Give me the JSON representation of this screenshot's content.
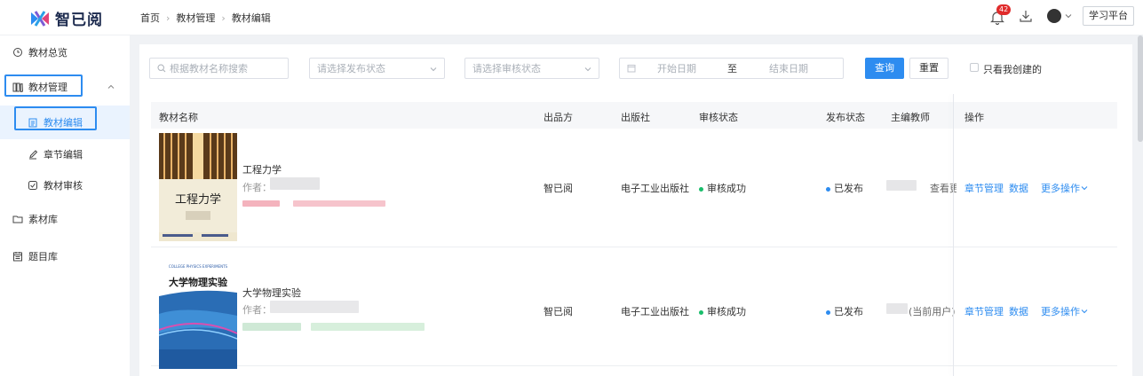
{
  "app": {
    "logo_text": "智已阅",
    "platform_button": "学习平台",
    "notification_count": "42"
  },
  "breadcrumb": [
    "首页",
    "教材管理",
    "教材编辑"
  ],
  "sidebar": {
    "items": [
      {
        "label": "教材总览",
        "icon": "clock-icon"
      },
      {
        "label": "教材管理",
        "icon": "books-icon"
      },
      {
        "label": "教材编辑",
        "icon": "clipboard-icon"
      },
      {
        "label": "章节编辑",
        "icon": "edit-icon"
      },
      {
        "label": "教材审核",
        "icon": "check-icon"
      },
      {
        "label": "素材库",
        "icon": "folder-icon"
      },
      {
        "label": "题目库",
        "icon": "calendar-icon"
      }
    ]
  },
  "filters": {
    "search_placeholder": "根据教材名称搜索",
    "publish_status_placeholder": "请选择发布状态",
    "review_status_placeholder": "请选择审核状态",
    "start_date_placeholder": "开始日期",
    "date_separator": "至",
    "end_date_placeholder": "结束日期",
    "query_button": "查询",
    "reset_button": "重置",
    "only_mine_label": "只看我创建的"
  },
  "table": {
    "headers": [
      "教材名称",
      "出品方",
      "出版社",
      "审核状态",
      "发布状态",
      "主编教师",
      "操作"
    ],
    "rows": [
      {
        "title": "工程力学",
        "author_label": "作者：",
        "producer": "智已阅",
        "publisher": "电子工业出版社",
        "review_status": "审核成功",
        "publish_status": "已发布",
        "teacher_extra": "查看更",
        "ops": [
          "章节管理",
          "数据",
          "更多操作"
        ],
        "cover_text": "工程力学"
      },
      {
        "title": "大学物理实验",
        "author_label": "作者：",
        "producer": "智已阅",
        "publisher": "电子工业出版社",
        "review_status": "审核成功",
        "publish_status": "已发布",
        "teacher_extra": "(当前用户)",
        "ops": [
          "章节管理",
          "数据",
          "更多操作"
        ],
        "cover_text": "大学物理实验",
        "cover_subtitle": "COLLEGE PHYSICS EXPERIMENTS"
      }
    ]
  },
  "colors": {
    "primary": "#2d8cf0",
    "success": "#19be6b",
    "badge": "#e02b2b"
  }
}
